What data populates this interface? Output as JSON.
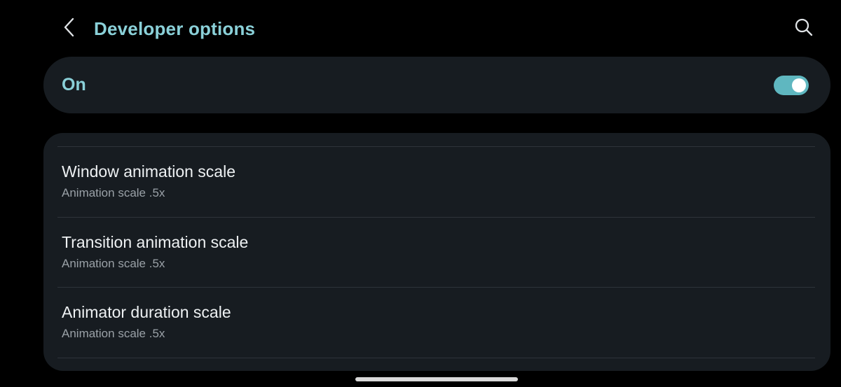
{
  "header": {
    "title": "Developer options",
    "back_icon": "chevron-left-icon",
    "search_icon": "search-icon"
  },
  "master_switch": {
    "label": "On",
    "enabled": true
  },
  "settings": [
    {
      "title": "Window animation scale",
      "summary": "Animation scale .5x"
    },
    {
      "title": "Transition animation scale",
      "summary": "Animation scale .5x"
    },
    {
      "title": "Animator duration scale",
      "summary": "Animation scale .5x"
    }
  ],
  "colors": {
    "accent": "#8ad0d8",
    "toggle_on": "#5fb7c0",
    "card_background": "#171c21",
    "background": "#000000"
  }
}
